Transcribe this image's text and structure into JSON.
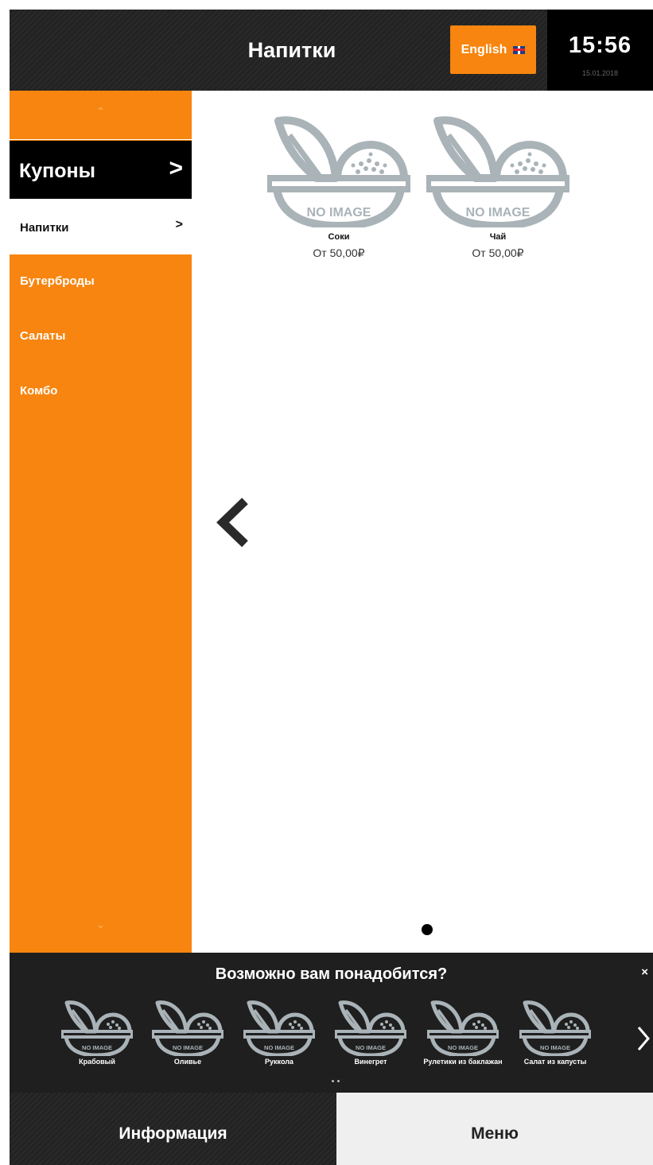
{
  "header": {
    "title": "Напитки",
    "language_button": "English",
    "time": "15:56",
    "date": "15.01.2018"
  },
  "sidebar": {
    "up_arrow": "⌃",
    "down_arrow": "⌄",
    "items": [
      {
        "label": "Купоны",
        "state": "highlighted"
      },
      {
        "label": "Напитки",
        "state": "selected"
      },
      {
        "label": "Бутерброды",
        "state": "default"
      },
      {
        "label": "Салаты",
        "state": "default"
      },
      {
        "label": "Комбо",
        "state": "default"
      }
    ]
  },
  "products": [
    {
      "name": "Соки",
      "price": "От 50,00₽",
      "placeholder": "NO IMAGE"
    },
    {
      "name": "Чай",
      "price": "От 50,00₽",
      "placeholder": "NO IMAGE"
    }
  ],
  "pagination": {
    "current_page": 1,
    "total_pages": 1
  },
  "recommendations": {
    "title": "Возможно вам понадобится?",
    "close": "×",
    "placeholder": "NO IMAGE",
    "items": [
      {
        "name": "Крабовый"
      },
      {
        "name": "Оливье"
      },
      {
        "name": "Руккола"
      },
      {
        "name": "Винегрет"
      },
      {
        "name": "Рулетики из баклажан"
      },
      {
        "name": "Салат из капусты"
      }
    ]
  },
  "footer": {
    "info_tab": "Информация",
    "menu_tab": "Меню"
  },
  "colors": {
    "accent": "#f7850f",
    "header_bg": "#232323",
    "placeholder_gray": "#a9b3b8"
  },
  "icons": [
    "chevron-up-icon",
    "chevron-down-icon",
    "chevron-right-icon",
    "chevron-left-icon",
    "close-icon",
    "uk-flag-icon",
    "no-image-bowl-icon"
  ]
}
